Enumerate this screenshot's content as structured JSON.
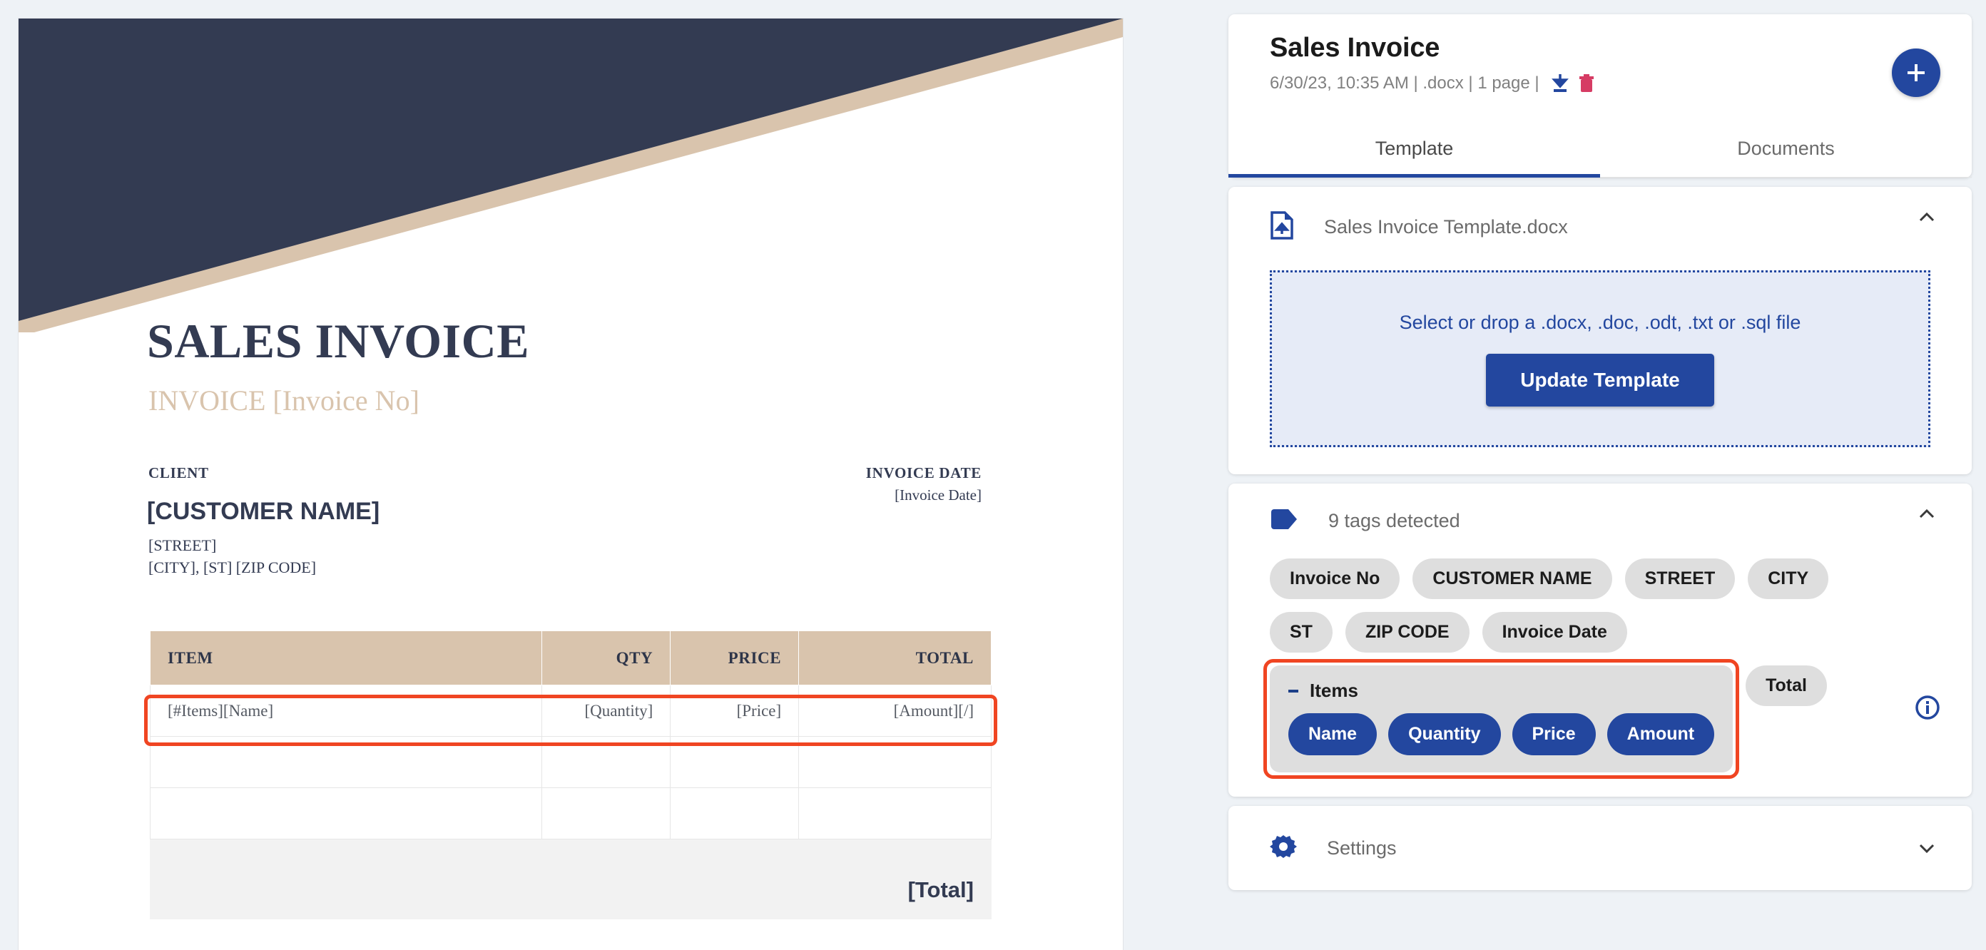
{
  "document_preview": {
    "title": "SALES INVOICE",
    "subtitle": "INVOICE [Invoice No]",
    "client_label": "CLIENT",
    "client_name": "[CUSTOMER NAME]",
    "client_street": "[STREET]",
    "client_city": "[CITY], [ST] [ZIP CODE]",
    "invoice_date_label": "INVOICE DATE",
    "invoice_date_value": "[Invoice Date]",
    "table": {
      "headers": [
        "ITEM",
        "QTY",
        "PRICE",
        "TOTAL"
      ],
      "rows": [
        [
          "[#Items][Name]",
          "[Quantity]",
          "[Price]",
          "[Amount][/]"
        ],
        [
          "",
          "",
          "",
          ""
        ],
        [
          "",
          "",
          "",
          ""
        ]
      ],
      "total_label": "[Total]"
    },
    "colors": {
      "banner_dark": "#333b52",
      "banner_tan": "#d9c4ad",
      "table_header_bg": "#d9c4ad",
      "highlight": "#f04522"
    }
  },
  "panel": {
    "heading": "Sales Invoice",
    "meta": "6/30/23, 10:35 AM | .docx | 1 page | ",
    "download_icon": "download-icon",
    "delete_icon": "trash-icon",
    "add_button_icon": "plus-icon",
    "tabs": [
      {
        "label": "Template",
        "active": true
      },
      {
        "label": "Documents",
        "active": false
      }
    ],
    "template_section": {
      "icon": "file-upload-icon",
      "filename": "Sales Invoice Template.docx",
      "collapse_icon": "chevron-up-icon",
      "dropzone_text": "Select or drop a .docx, .doc, .odt, .txt or .sql file",
      "update_button": "Update Template"
    },
    "tags_section": {
      "icon": "tag-icon",
      "title": "9 tags detected",
      "collapse_icon": "chevron-up-icon",
      "info_icon": "info-icon",
      "tags": [
        "Invoice No",
        "CUSTOMER NAME",
        "STREET",
        "CITY",
        "ST",
        "ZIP CODE",
        "Invoice Date"
      ],
      "group": {
        "name": "Items",
        "highlighted": true,
        "children": [
          "Name",
          "Quantity",
          "Price",
          "Amount"
        ]
      },
      "trailing_tags": [
        "Total"
      ]
    },
    "settings_section": {
      "icon": "gear-icon",
      "label": "Settings",
      "collapse_icon": "chevron-down-icon"
    },
    "colors": {
      "primary": "#23479f",
      "delete": "#d63c64",
      "chip_bg": "#dedede",
      "highlight": "#f04522"
    }
  }
}
